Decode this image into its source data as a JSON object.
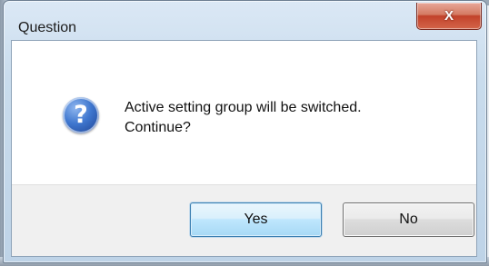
{
  "dialog": {
    "title": "Question",
    "close_glyph": "X",
    "icon": "question-icon",
    "icon_glyph": "?",
    "message_line1": "Active setting group will be switched.",
    "message_line2": "Continue?",
    "yes_label": "Yes",
    "no_label": "No"
  }
}
